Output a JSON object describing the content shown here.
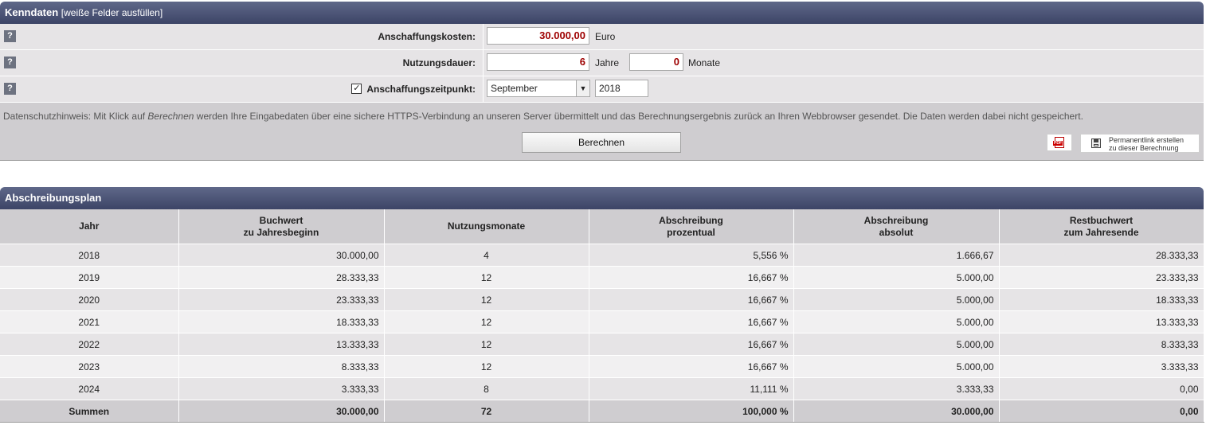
{
  "kenndaten": {
    "title": "Kenndaten",
    "subtitle": "[weiße Felder ausfüllen]",
    "help_label": "?",
    "anschaffungskosten": {
      "label": "Anschaffungskosten:",
      "value": "30.000,00",
      "unit": "Euro"
    },
    "nutzungsdauer": {
      "label": "Nutzungsdauer:",
      "years_value": "6",
      "years_unit": "Jahre",
      "months_value": "0",
      "months_unit": "Monate"
    },
    "anschaffungszeitpunkt": {
      "label": "Anschaffungszeitpunkt:",
      "checked": true,
      "checkmark": "✓",
      "month": "September",
      "year": "2018"
    },
    "notice_prefix": "Datenschutzhinweis: Mit Klick auf ",
    "notice_em": "Berechnen",
    "notice_suffix": " werden Ihre Eingabedaten über eine sichere HTTPS-Verbindung an unseren Server übermittelt und das Berechnungsergebnis zurück an Ihren Webbrowser gesendet. Die Daten werden dabei nicht gespeichert.",
    "calc_button": "Berechnen",
    "pdf_label": "PDF",
    "permalink_line1": "Permanentlink erstellen",
    "permalink_line2": "zu dieser Berechnung"
  },
  "plan": {
    "title": "Abschreibungsplan",
    "headers": [
      [
        "Jahr",
        ""
      ],
      [
        "Buchwert",
        "zu Jahresbeginn"
      ],
      [
        "Nutzungsmonate",
        ""
      ],
      [
        "Abschreibung",
        "prozentual"
      ],
      [
        "Abschreibung",
        "absolut"
      ],
      [
        "Restbuchwert",
        "zum Jahresende"
      ]
    ],
    "rows": [
      [
        "2018",
        "30.000,00",
        "4",
        "5,556 %",
        "1.666,67",
        "28.333,33"
      ],
      [
        "2019",
        "28.333,33",
        "12",
        "16,667 %",
        "5.000,00",
        "23.333,33"
      ],
      [
        "2020",
        "23.333,33",
        "12",
        "16,667 %",
        "5.000,00",
        "18.333,33"
      ],
      [
        "2021",
        "18.333,33",
        "12",
        "16,667 %",
        "5.000,00",
        "13.333,33"
      ],
      [
        "2022",
        "13.333,33",
        "12",
        "16,667 %",
        "5.000,00",
        "8.333,33"
      ],
      [
        "2023",
        "8.333,33",
        "12",
        "16,667 %",
        "5.000,00",
        "3.333,33"
      ],
      [
        "2024",
        "3.333,33",
        "8",
        "11,111 %",
        "3.333,33",
        "0,00"
      ]
    ],
    "sum": [
      "Summen",
      "30.000,00",
      "72",
      "100,000 %",
      "30.000,00",
      "0,00"
    ]
  }
}
